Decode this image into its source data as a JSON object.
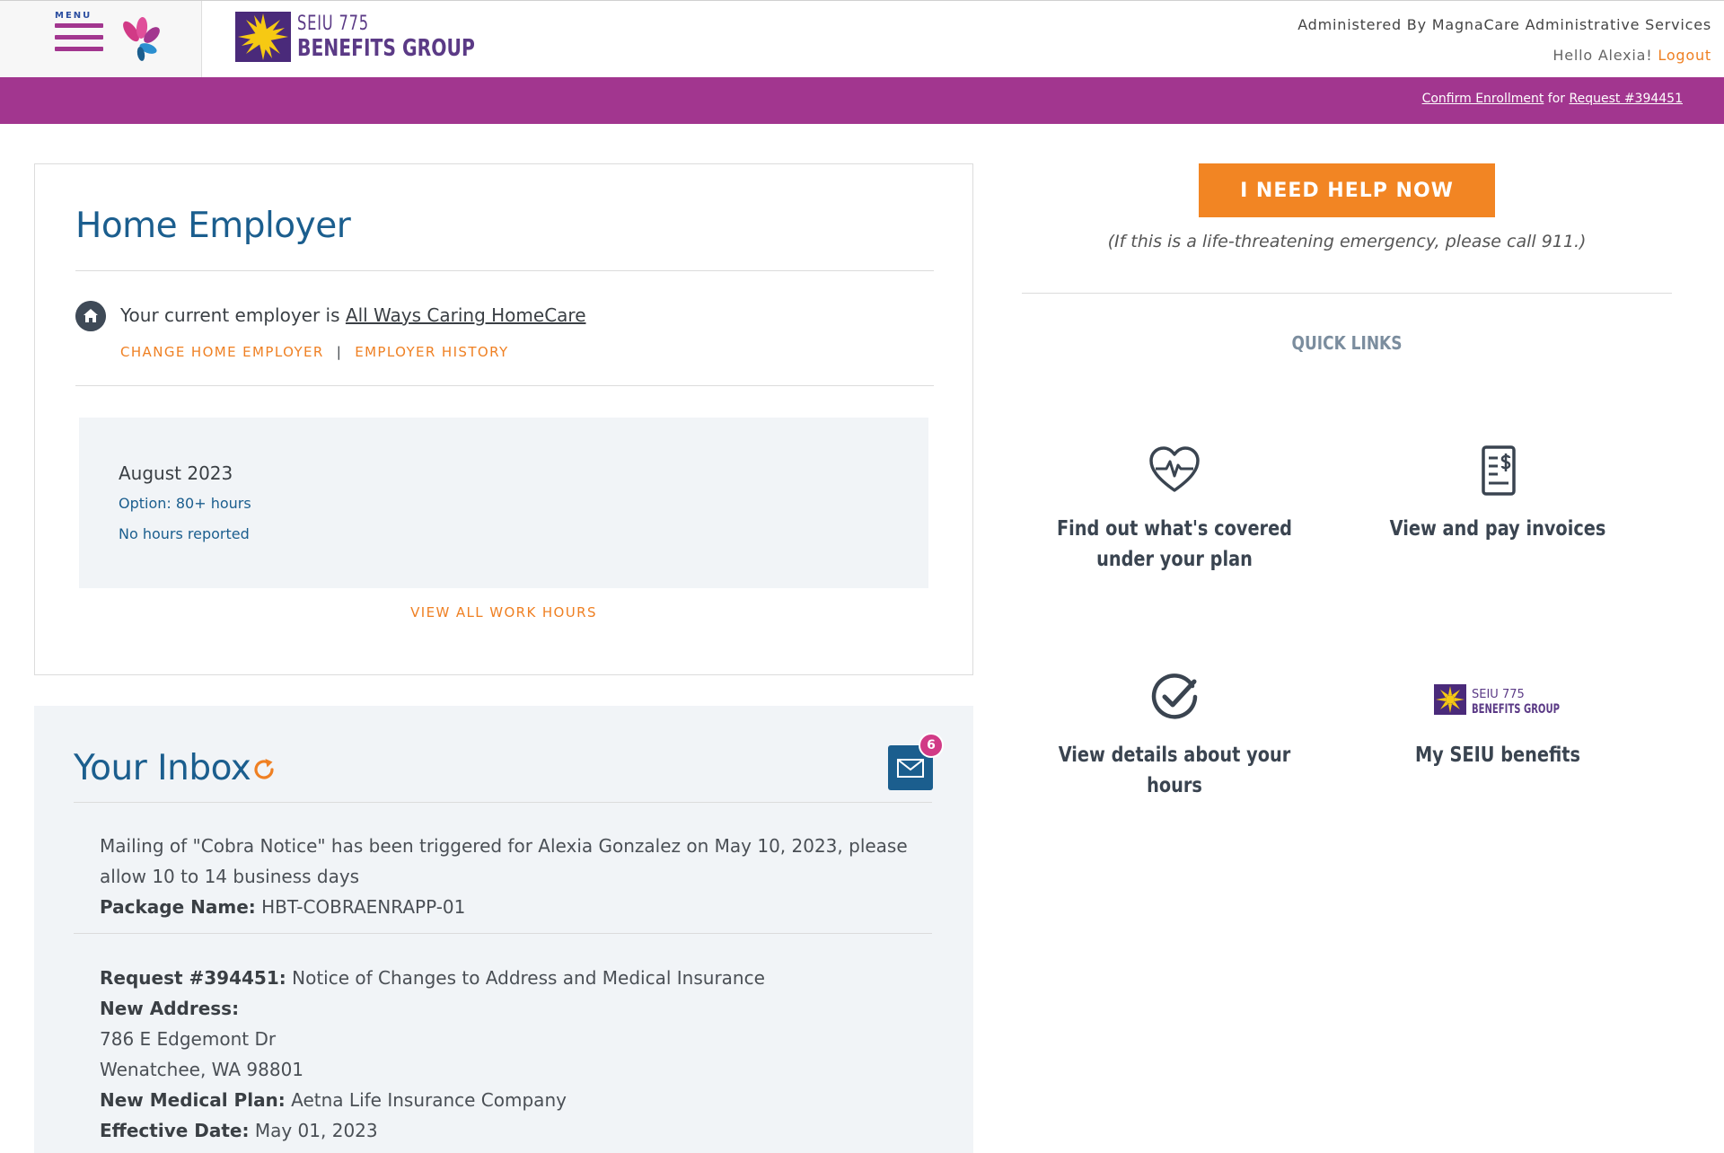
{
  "header": {
    "menu_label": "MENU",
    "brand_line1": "SEIU 775",
    "brand_line2": "BENEFITS GROUP",
    "administered_by": "Administered By MagnaCare Administrative Services",
    "greeting": "Hello Alexia!",
    "logout_label": "Logout"
  },
  "banner": {
    "confirm_link": "Confirm Enrollment",
    "middle_text": "for",
    "request_link": "Request #394451"
  },
  "employer": {
    "title": "Home Employer",
    "current_prefix": "Your current employer is",
    "employer_name": "All Ways Caring HomeCare",
    "change_link": "CHANGE HOME EMPLOYER",
    "separator": "|",
    "history_link": "EMPLOYER HISTORY",
    "hours_month": "August 2023",
    "hours_option": "Option: 80+ hours",
    "hours_reported": "No hours reported",
    "view_all_hours": "VIEW ALL WORK HOURS"
  },
  "inbox": {
    "title": "Your Inbox",
    "unread_count": "6",
    "messages": [
      {
        "line1": "Mailing of \"Cobra Notice\" has been triggered for Alexia Gonzalez on May 10, 2023, please",
        "line2": "allow 10 to 14 business days",
        "package_label": "Package Name:",
        "package_value": "HBT-COBRAENRAPP-01"
      },
      {
        "request_label": "Request #394451:",
        "request_value": "Notice of Changes to Address and Medical Insurance",
        "address_label": "New Address:",
        "address_line1": "786 E Edgemont Dr",
        "address_line2": "Wenatchee, WA 98801",
        "plan_label": "New Medical Plan:",
        "plan_value": "Aetna Life Insurance Company",
        "date_label": "Effective Date:",
        "date_value": "May 01, 2023"
      }
    ]
  },
  "help": {
    "button_label": "I NEED HELP NOW",
    "note": "(If this is a life-threatening emergency, please call 911.)"
  },
  "quick_links": {
    "title": "QUICK LINKS",
    "items": [
      {
        "label": "Find out what's covered under your plan",
        "icon": "heart-pulse-icon"
      },
      {
        "label": "View and pay invoices",
        "icon": "invoice-icon"
      },
      {
        "label": "View details about your hours",
        "icon": "check-circle-icon"
      },
      {
        "label": "My SEIU benefits",
        "icon": "seiu-logo"
      }
    ]
  },
  "colors": {
    "brand_purple": "#a2368f",
    "accent_orange": "#f28523",
    "heading_blue": "#1b5e8e",
    "badge_pink": "#d13a86"
  }
}
